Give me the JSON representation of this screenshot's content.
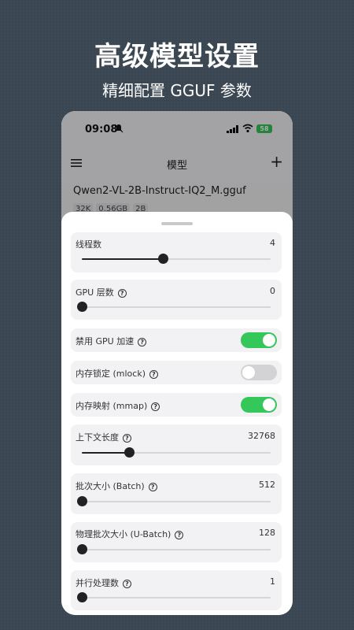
{
  "promo": {
    "title": "高级模型设置",
    "subtitle": "精细配置 GGUF 参数"
  },
  "status_bar": {
    "time": "09:08",
    "battery": "58",
    "colors": {
      "battery": "#34c759"
    }
  },
  "nav": {
    "title": "模型",
    "add_label": "+"
  },
  "model": {
    "name": "Qwen2-VL-2B-Instruct-IQ2_M.gguf",
    "tags": [
      "32K",
      "0.56GB",
      "2B"
    ]
  },
  "settings": {
    "threads": {
      "label": "线程数",
      "value": "4",
      "fraction": 0.43
    },
    "gpu_layers": {
      "label": "GPU 层数",
      "value": "0",
      "fraction": 0.0
    },
    "disable_gpu_accel": {
      "label": "禁用 GPU 加速",
      "on": true
    },
    "mlock": {
      "label": "内存锁定 (mlock)",
      "on": false
    },
    "mmap": {
      "label": "内存映射 (mmap)",
      "on": true
    },
    "context_length": {
      "label": "上下文长度",
      "value": "32768",
      "fraction": 0.25
    },
    "batch": {
      "label": "批次大小 (Batch)",
      "value": "512",
      "fraction": 0.0
    },
    "ubatch": {
      "label": "物理批次大小 (U-Batch)",
      "value": "128",
      "fraction": 0.0
    },
    "parallel": {
      "label": "并行处理数",
      "value": "1",
      "fraction": 0.0
    }
  },
  "help_glyph": "?",
  "colors": {
    "toggle_on": "#34c759",
    "toggle_off": "#d3d3d6",
    "background": "#3a4652"
  }
}
